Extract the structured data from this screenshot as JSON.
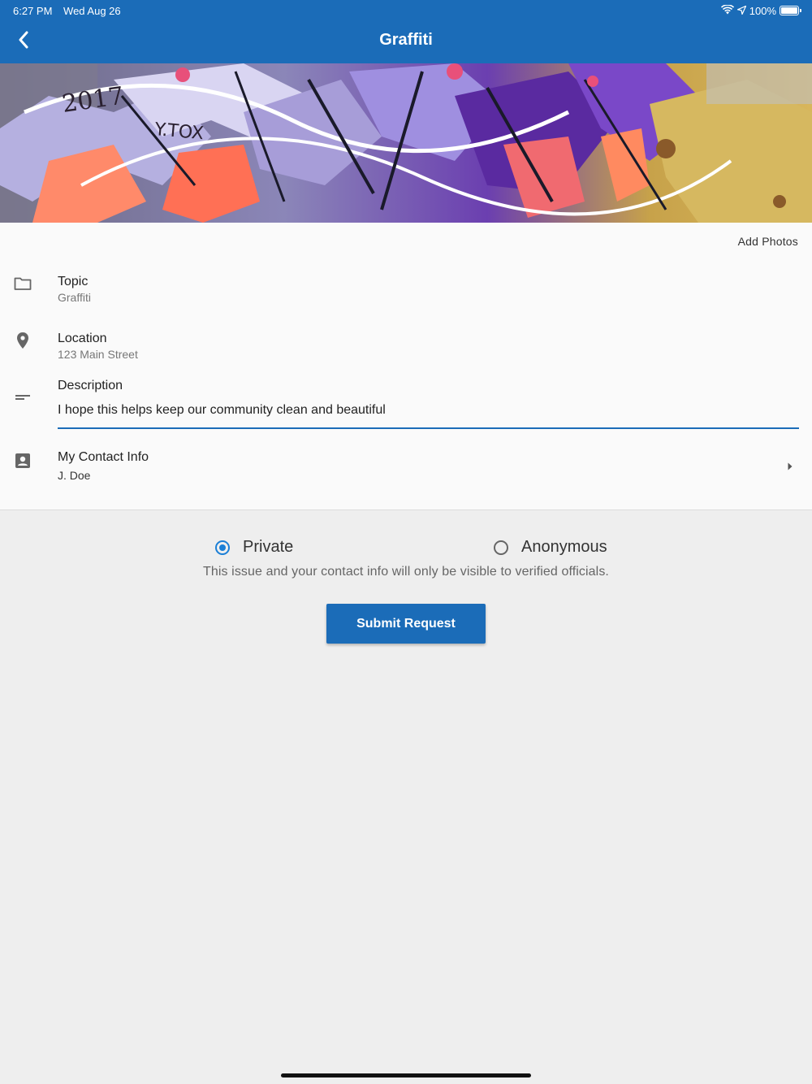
{
  "status_bar": {
    "time": "6:27 PM",
    "date": "Wed Aug 26",
    "battery": "100%"
  },
  "header": {
    "title": "Graffiti",
    "back_icon": "chevron-left-icon"
  },
  "hero_image": {
    "tag_text": "2017",
    "tag_text_2": "Y.TOX"
  },
  "add_photos_label": "Add Photos",
  "fields": {
    "topic": {
      "label": "Topic",
      "value": "Graffiti",
      "icon": "folder-icon"
    },
    "location": {
      "label": "Location",
      "value": "123 Main Street",
      "icon": "location-pin-icon"
    },
    "description": {
      "label": "Description",
      "value": "I hope this helps keep our community clean and beautiful",
      "icon": "description-lines-icon"
    },
    "contact": {
      "label": "My Contact Info",
      "value": "J. Doe",
      "icon": "contact-card-icon"
    }
  },
  "visibility": {
    "options": [
      "Private",
      "Anonymous"
    ],
    "selected": "Private",
    "note": "This issue and your contact info will only be visible to verified officials."
  },
  "submit_label": "Submit Request",
  "colors": {
    "primary": "#1b6cb8",
    "radio_active": "#1b7fd6",
    "background": "#eeeeee",
    "form_bg": "#fafafa"
  }
}
